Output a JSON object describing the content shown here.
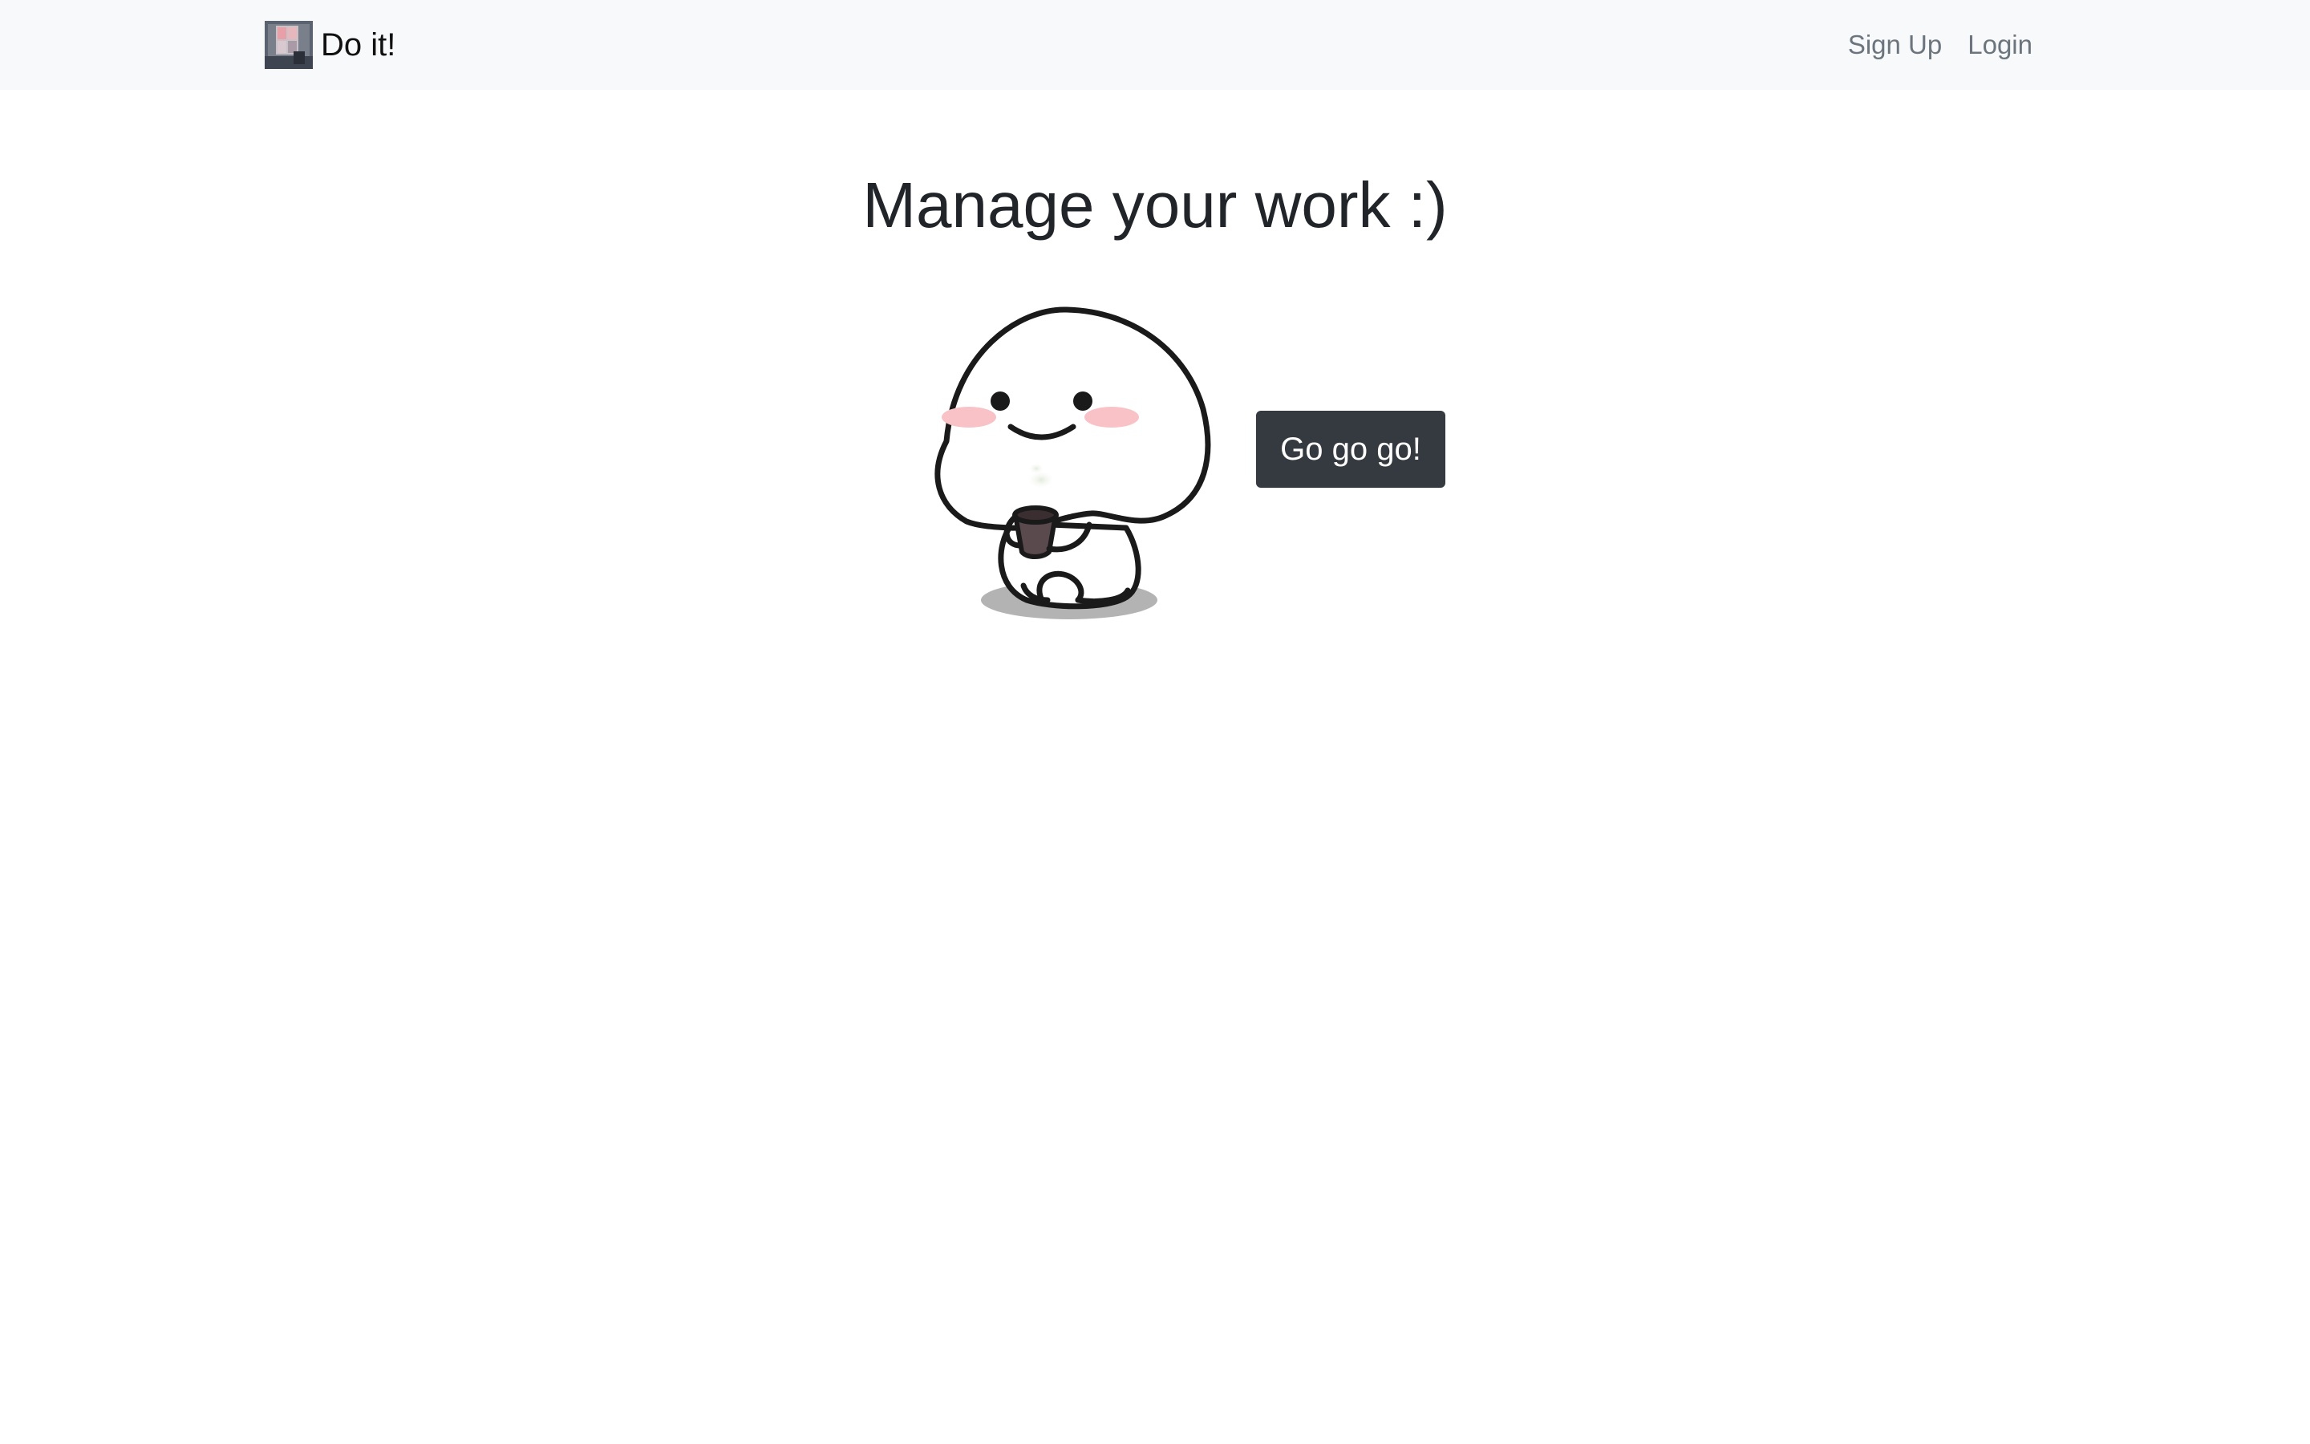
{
  "navbar": {
    "brand_text": "Do it!",
    "brand_logo_icon": "app-logo-icon",
    "links": [
      {
        "label": "Sign Up"
      },
      {
        "label": "Login"
      }
    ]
  },
  "hero": {
    "headline": "Manage your work :)",
    "mascot_icon": "mascot-illustration",
    "cta_label": "Go go go!"
  },
  "colors": {
    "navbar_bg": "#f8f9fa",
    "nav_link": "#6c757d",
    "headline": "#212529",
    "cta_bg": "#343a40",
    "cta_text": "#ffffff"
  }
}
